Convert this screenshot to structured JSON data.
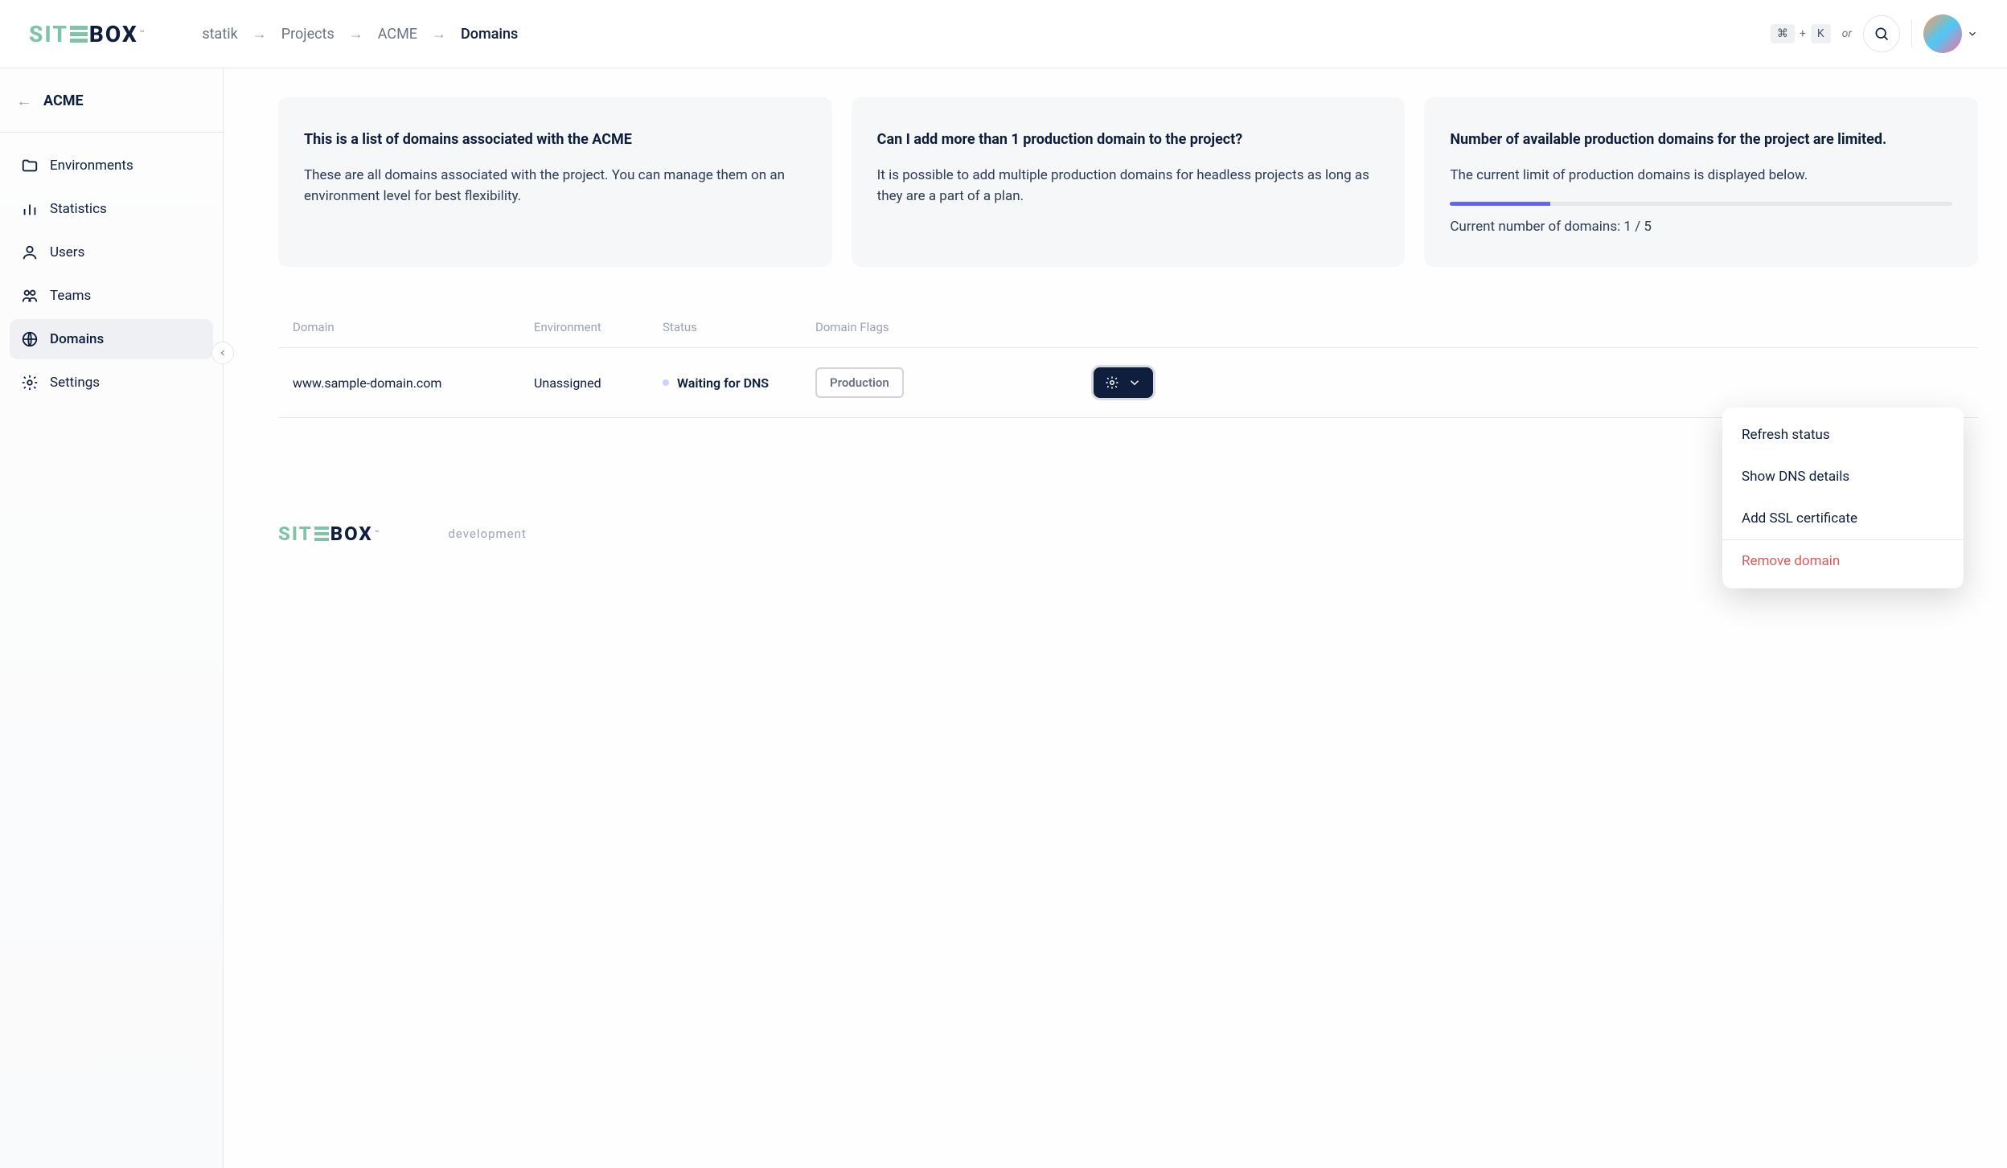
{
  "breadcrumb": {
    "items": [
      "statik",
      "Projects",
      "ACME"
    ],
    "current": "Domains"
  },
  "header": {
    "kbd1": "⌘",
    "plus": "+",
    "kbd2": "K",
    "or": "or"
  },
  "sidebar": {
    "title": "ACME",
    "items": [
      {
        "label": "Environments"
      },
      {
        "label": "Statistics"
      },
      {
        "label": "Users"
      },
      {
        "label": "Teams"
      },
      {
        "label": "Domains"
      },
      {
        "label": "Settings"
      }
    ]
  },
  "cards": {
    "c1": {
      "title": "This is a list of domains associated with the ACME",
      "text": "These are all domains associated with the project. You can manage them on an environment level for best flexibility."
    },
    "c2": {
      "title": "Can I add more than 1 production domain to the project?",
      "text": "It is possible to add multiple production domains for headless projects as long as they are a part of a plan."
    },
    "c3": {
      "title": "Number of available production domains for the project are limited.",
      "text": "The current limit of production domains is displayed below.",
      "count": "Current number of domains: 1 / 5"
    }
  },
  "table": {
    "headers": {
      "domain": "Domain",
      "environment": "Environment",
      "status": "Status",
      "flags": "Domain Flags"
    },
    "row": {
      "domain": "www.sample-domain.com",
      "environment": "Unassigned",
      "status": "Waiting for DNS",
      "flag": "Production"
    }
  },
  "dropdown": {
    "refresh": "Refresh status",
    "dns": "Show DNS details",
    "ssl": "Add SSL certificate",
    "remove": "Remove domain"
  },
  "footer": {
    "sub": "development"
  }
}
